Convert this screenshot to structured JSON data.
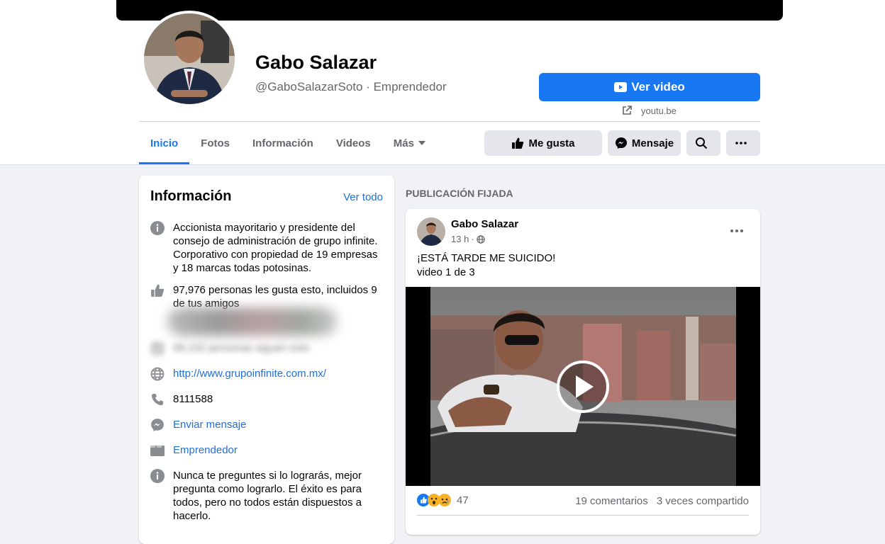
{
  "header": {
    "page_name": "Gabo Salazar",
    "handle_category": "@GaboSalazarSoto · Emprendedor",
    "cta_label": "Ver video",
    "cta_link": "youtu.be",
    "accent_color": "#1877f2"
  },
  "tabs": [
    {
      "label": "Inicio",
      "active": true
    },
    {
      "label": "Fotos"
    },
    {
      "label": "Información"
    },
    {
      "label": "Videos"
    },
    {
      "label": "Más"
    }
  ],
  "actions": {
    "like_label": "Me gusta",
    "message_label": "Mensaje",
    "search_icon": "search-icon",
    "more_icon": "more-icon"
  },
  "info": {
    "title": "Información",
    "see_all": "Ver todo",
    "about": "Accionista mayoritario y presidente del consejo de administración de grupo infinite. Corporativo con propiedad de 19 empresas y 18 marcas todas potosinas.",
    "likes": "97,976 personas les gusta esto, incluidos 9 de tus amigos",
    "followers": "99,152 personas siguen esto",
    "website": "http://www.grupoinfinite.com.mx/",
    "phone": "8111588",
    "send_message": "Enviar mensaje",
    "category": "Emprendedor",
    "quote": "Nunca te preguntes si lo lograrás, mejor pregunta como lograrlo. El éxito es para todos, pero no todos están dispuestos a hacerlo."
  },
  "pinned": {
    "section_label": "PUBLICACIÓN FIJADA",
    "author": "Gabo Salazar",
    "time": "13 h",
    "text": "¡ESTÁ TARDE ME SUICIDO!",
    "subtext": "video 1 de 3",
    "reaction_count": "47",
    "comments": "19 comentarios",
    "shares": "3 veces compartido"
  }
}
